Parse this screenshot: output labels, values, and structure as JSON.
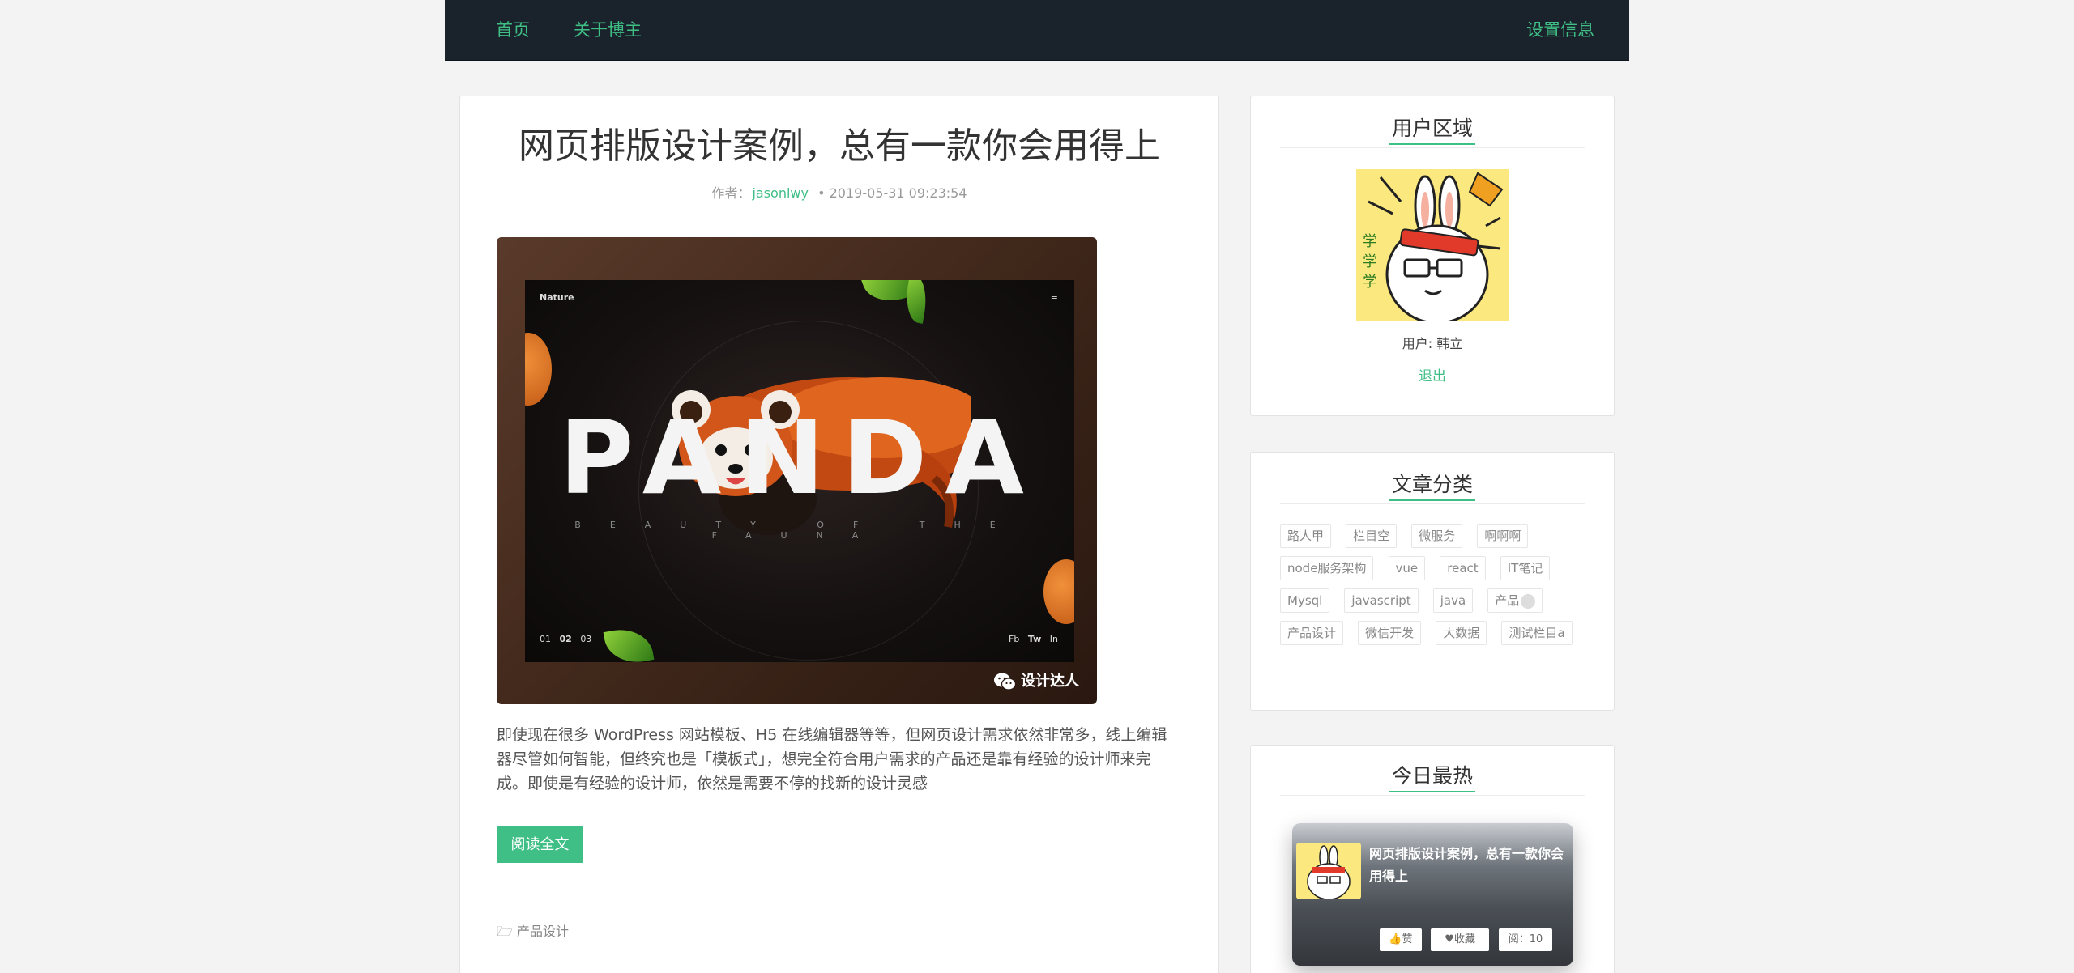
{
  "nav": {
    "home": "首页",
    "about": "关于博主",
    "settings": "设置信息"
  },
  "post": {
    "title": "网页排版设计案例，总有一款你会用得上",
    "author_label": "作者：",
    "author": "jasonlwy",
    "date": "• 2019-05-31 09:23:54",
    "cover": {
      "corner_label": "Nature",
      "headline": "PANDA",
      "subline": "BEAUTY OF THE FAUNA",
      "pager": [
        "01",
        "02",
        "03"
      ],
      "social": [
        "Fb",
        "Tw",
        "In"
      ],
      "watermark": "设计达人"
    },
    "excerpt": "即使现在很多 WordPress 网站模板、H5 在线编辑器等等，但网页设计需求依然非常多，线上编辑器尽管如何智能，但终究也是「模板式」，想完全符合用户需求的产品还是靠有经验的设计师来完成。即使是有经验的设计师，依然是需要不停的找新的设计灵感",
    "read_more": "阅读全文",
    "category": "产品设计"
  },
  "user_panel": {
    "title": "用户区域",
    "user_text": "用户: 韩立",
    "logout": "退出"
  },
  "category_panel": {
    "title": "文章分类",
    "tags": [
      "路人甲",
      "栏目空",
      "微服务",
      "啊啊啊",
      "node服务架构",
      "vue",
      "react",
      "IT笔记",
      "Mysql",
      "javascript",
      "java",
      "产品",
      "产品设计",
      "微信开发",
      "大数据",
      "测试栏目a"
    ]
  },
  "hot_panel": {
    "title": "今日最热",
    "item_title": "网页排版设计案例，总有一款你会用得上",
    "like": "赞",
    "favorite": "收藏",
    "views": "阅：10"
  },
  "colors": {
    "accent": "#3fbf86",
    "nav_bg": "#1a232b",
    "page_bg": "#f3f3f3"
  }
}
